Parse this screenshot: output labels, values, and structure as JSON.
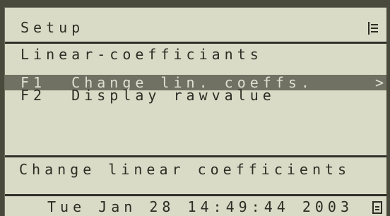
{
  "header": {
    "title": "Setup",
    "menu_icon": "menu-list-icon"
  },
  "section": {
    "title": "Linear-coefficiants"
  },
  "menu": {
    "items": [
      {
        "label": "F1  Change lin. coeffs.",
        "selected": true,
        "arrow": ">"
      },
      {
        "label": "F2  Display rawvalue",
        "selected": false,
        "arrow": ""
      }
    ]
  },
  "status": {
    "text": "Change linear coefficients"
  },
  "footer": {
    "datetime": "Tue Jan 28 14:49:44 2003",
    "icon": "status-box-icon"
  },
  "colors": {
    "lcd_background": "#dadbc6",
    "lcd_text": "#2c2d24",
    "selection": "#707163"
  }
}
